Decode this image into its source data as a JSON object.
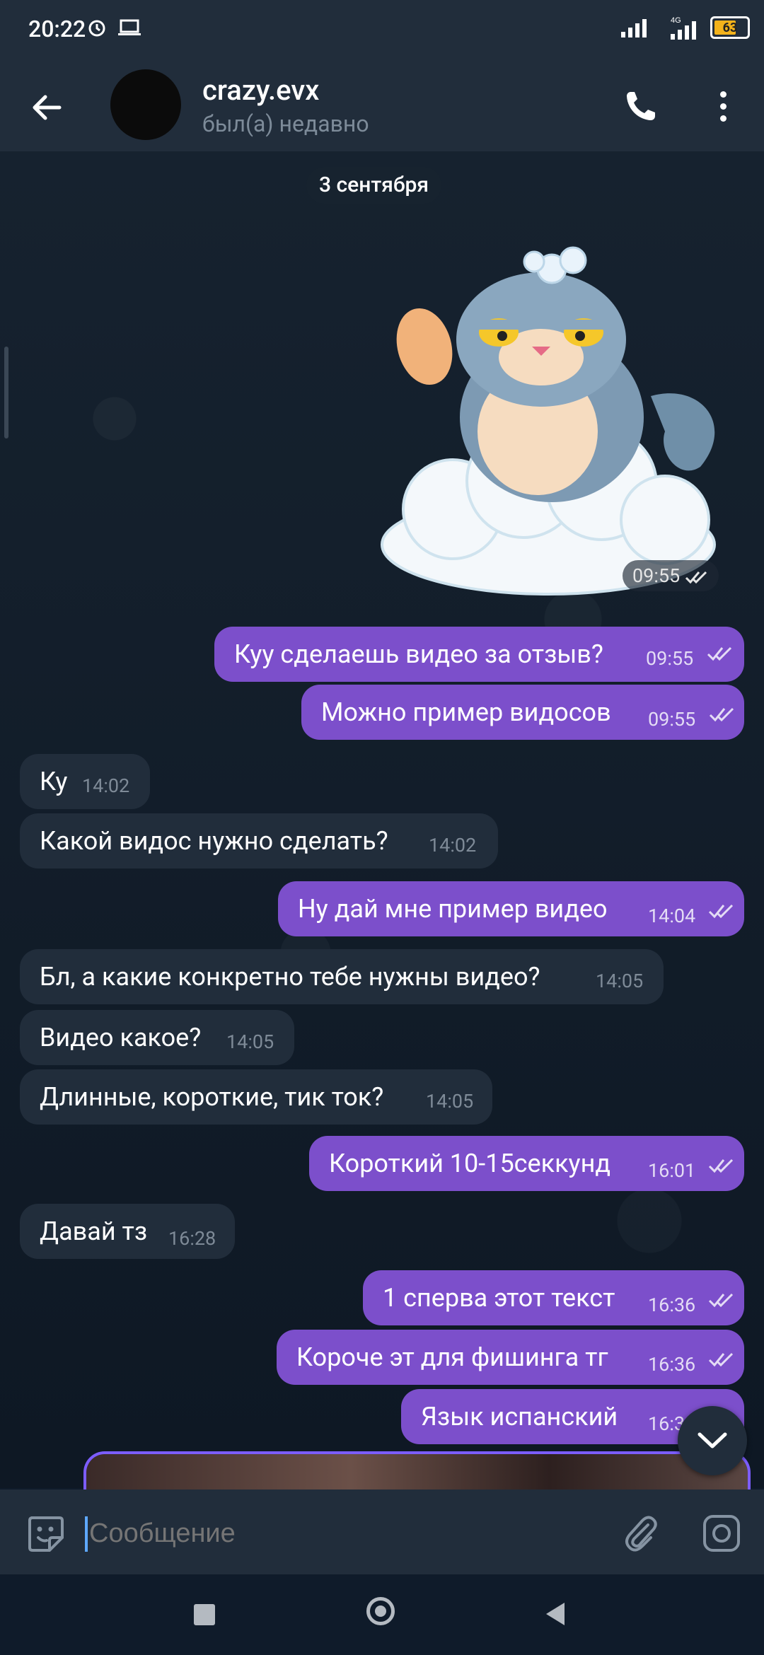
{
  "status_bar": {
    "time": "20:22",
    "battery": "63",
    "network": "4G"
  },
  "header": {
    "name": "crazy.evx",
    "status": "был(а) недавно"
  },
  "chat": {
    "date_separator": "3 сентября",
    "sticker_time": "09:55",
    "messages": [
      {
        "dir": "out",
        "text": "Куу сделаешь видео за отзыв?",
        "time": "09:55"
      },
      {
        "dir": "out",
        "text": "Можно пример видосов",
        "time": "09:55"
      },
      {
        "dir": "in",
        "text": "Ку",
        "time": "14:02"
      },
      {
        "dir": "in",
        "text": "Какой видос нужно сделать?",
        "time": "14:02"
      },
      {
        "dir": "out",
        "text": "Ну дай мне пример видео",
        "time": "14:04"
      },
      {
        "dir": "in",
        "text": "Бл, а какие конкретно тебе нужны видео?",
        "time": "14:05"
      },
      {
        "dir": "in",
        "text": "Видео какое?",
        "time": "14:05"
      },
      {
        "dir": "in",
        "text": "Длинные, короткие, тик ток?",
        "time": "14:05"
      },
      {
        "dir": "out",
        "text": "Короткий 10-15секкунд",
        "time": "16:01"
      },
      {
        "dir": "in",
        "text": "Давай тз",
        "time": "16:28"
      },
      {
        "dir": "out",
        "text": "1 сперва этот текст",
        "time": "16:36"
      },
      {
        "dir": "out",
        "text": "Короче эт для фишинга тг",
        "time": "16:36"
      },
      {
        "dir": "out",
        "text": "Язык испанский",
        "time": "16:3"
      }
    ]
  },
  "input": {
    "placeholder": "Сообщение"
  },
  "colors": {
    "outgoing": "#7c4fcb",
    "incoming": "#212d3b",
    "header": "#212d3b",
    "accent": "#5ea8ff"
  },
  "icons": [
    "back-arrow-icon",
    "phone-icon",
    "more-vert-icon",
    "sticker-icon",
    "attach-icon",
    "camera-icon",
    "double-check-icon",
    "chevron-down-icon"
  ]
}
